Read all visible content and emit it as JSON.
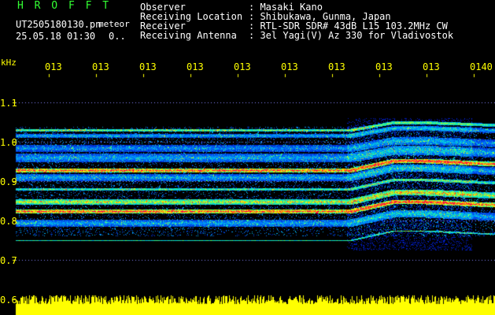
{
  "header": {
    "station": "H R O F F T",
    "filename": "UT2505180130.pn",
    "label_meteor": "meteor",
    "datetime": "25.05.18 01:30",
    "page_indicator": "0.."
  },
  "info": [
    {
      "key": "Observer",
      "value": ": Masaki Kano"
    },
    {
      "key": "Receiving Location",
      "value": ": Shibukawa, Gunma, Japan"
    },
    {
      "key": "Receiver",
      "value": ": RTL-SDR SDR# 43dB L15 103.2MHz CW"
    },
    {
      "key": "Receiving Antenna",
      "value": ": 3el Yagi(V) Az 330 for Vladivostok"
    }
  ],
  "time_axis": {
    "labels": [
      "013",
      "013",
      "013",
      "013",
      "013",
      "013",
      "013",
      "013",
      "013",
      "0140"
    ]
  },
  "freq_axis": {
    "unit": "kHz",
    "labels": [
      "1.1",
      "1.0",
      "0.9",
      "0.8",
      "0.7",
      "0.6"
    ]
  },
  "colors": {
    "background": "#000000",
    "text": "#ffffff",
    "station": "#33ff33",
    "axis": "#ffff00",
    "noise_band": "#ffff00"
  }
}
